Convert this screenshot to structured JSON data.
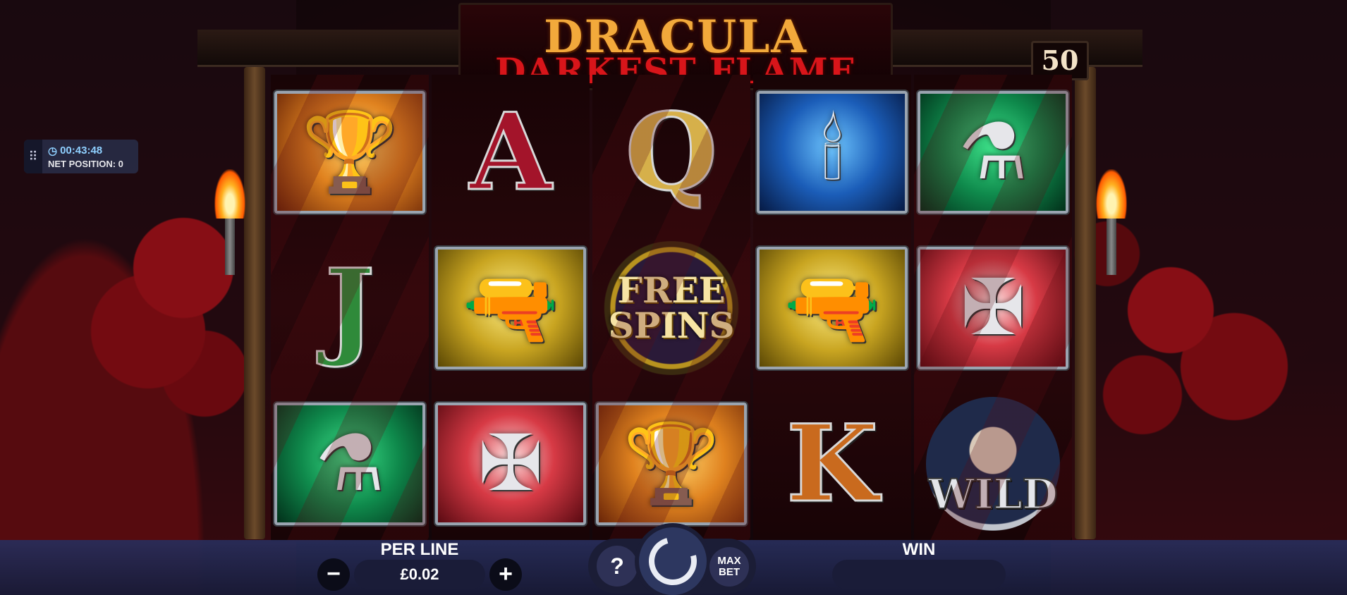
{
  "game": {
    "title_line1": "DRACULA",
    "title_line2": "DARKEST FLAME",
    "lines": "50"
  },
  "session": {
    "time": "00:43:48",
    "net_position": "NET POSITION: 0"
  },
  "reels": [
    [
      {
        "symbol": "chalice",
        "icon": "silver-chalice-icon",
        "glyph": "🏆",
        "tile": "orange"
      },
      {
        "symbol": "J",
        "letter": "J",
        "tile": "none"
      },
      {
        "symbol": "vial",
        "icon": "potion-vial-icon",
        "glyph": "⚗",
        "tile": "green"
      }
    ],
    [
      {
        "symbol": "A",
        "letter": "A",
        "tile": "none"
      },
      {
        "symbol": "pistol",
        "icon": "pistol-icon",
        "glyph": "🔫",
        "tile": "gold"
      },
      {
        "symbol": "cross",
        "icon": "ornate-cross-icon",
        "glyph": "✠",
        "tile": "red"
      }
    ],
    [
      {
        "symbol": "Q",
        "letter": "Q",
        "tile": "none"
      },
      {
        "symbol": "free_spins",
        "label_line1": "FREE",
        "label_line2": "SPINS"
      },
      {
        "symbol": "chalice",
        "icon": "silver-chalice-icon",
        "glyph": "🏆",
        "tile": "orange"
      }
    ],
    [
      {
        "symbol": "candles",
        "icon": "candles-icon",
        "glyph": "🕯",
        "tile": "blue"
      },
      {
        "symbol": "pistol",
        "icon": "pistol-icon",
        "glyph": "🔫",
        "tile": "gold"
      },
      {
        "symbol": "K",
        "letter": "K",
        "tile": "none"
      }
    ],
    [
      {
        "symbol": "vial",
        "icon": "potion-vial-icon",
        "glyph": "⚗",
        "tile": "green"
      },
      {
        "symbol": "cross",
        "icon": "ornate-cross-icon",
        "glyph": "✠",
        "tile": "red"
      },
      {
        "symbol": "wild",
        "label": "WILD"
      }
    ]
  ],
  "controls": {
    "per_line_label": "PER LINE",
    "per_line_value": "£0.02",
    "minus": "−",
    "plus": "+",
    "help": "?",
    "max_bet_line1": "MAX",
    "max_bet_line2": "BET",
    "win_label": "WIN",
    "win_value": ""
  }
}
